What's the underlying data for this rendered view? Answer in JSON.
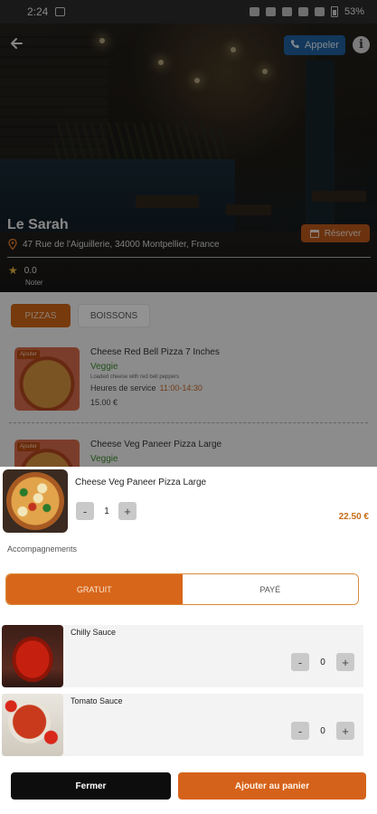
{
  "status_bar": {
    "time": "2:24",
    "battery": "53%"
  },
  "hero": {
    "restaurant_name": "Le Sarah",
    "address": "47 Rue de l'Aiguillerie, 34000 Montpellier, France",
    "rating_value": "0.0",
    "rating_label": "Noter",
    "call_label": "Appeler",
    "reserve_label": "Réserver"
  },
  "categories": {
    "active": "PIZZAS",
    "inactive": "BOISSONS"
  },
  "menu": [
    {
      "badge": "Ajouter",
      "title": "Cheese Red Bell Pizza 7 Inches",
      "tag": "Veggie",
      "desc": "Loaded cheese with red bell peppers",
      "hours_label": "Heures de service",
      "hours": "11:00-14:30",
      "price": "15.00 €"
    },
    {
      "badge": "Ajouter",
      "title": "Cheese Veg Paneer Pizza Large",
      "tag": "Veggie"
    }
  ],
  "sheet": {
    "product_title": "Cheese Veg Paneer Pizza Large",
    "minus": "-",
    "plus": "+",
    "quantity": "1",
    "price": "22.50 €",
    "accomp_label": "Accompagnements",
    "toggle": {
      "free": "GRATUIT",
      "paid": "PAYÉ"
    },
    "sides": [
      {
        "name": "Chilly Sauce",
        "qty": "0"
      },
      {
        "name": "Tomato Sauce",
        "qty": "0"
      }
    ],
    "close_label": "Fermer",
    "add_label": "Ajouter au panier"
  },
  "colors": {
    "accent": "#d5621a",
    "veggie": "#3c8a2e",
    "call": "#1f5f9e"
  }
}
